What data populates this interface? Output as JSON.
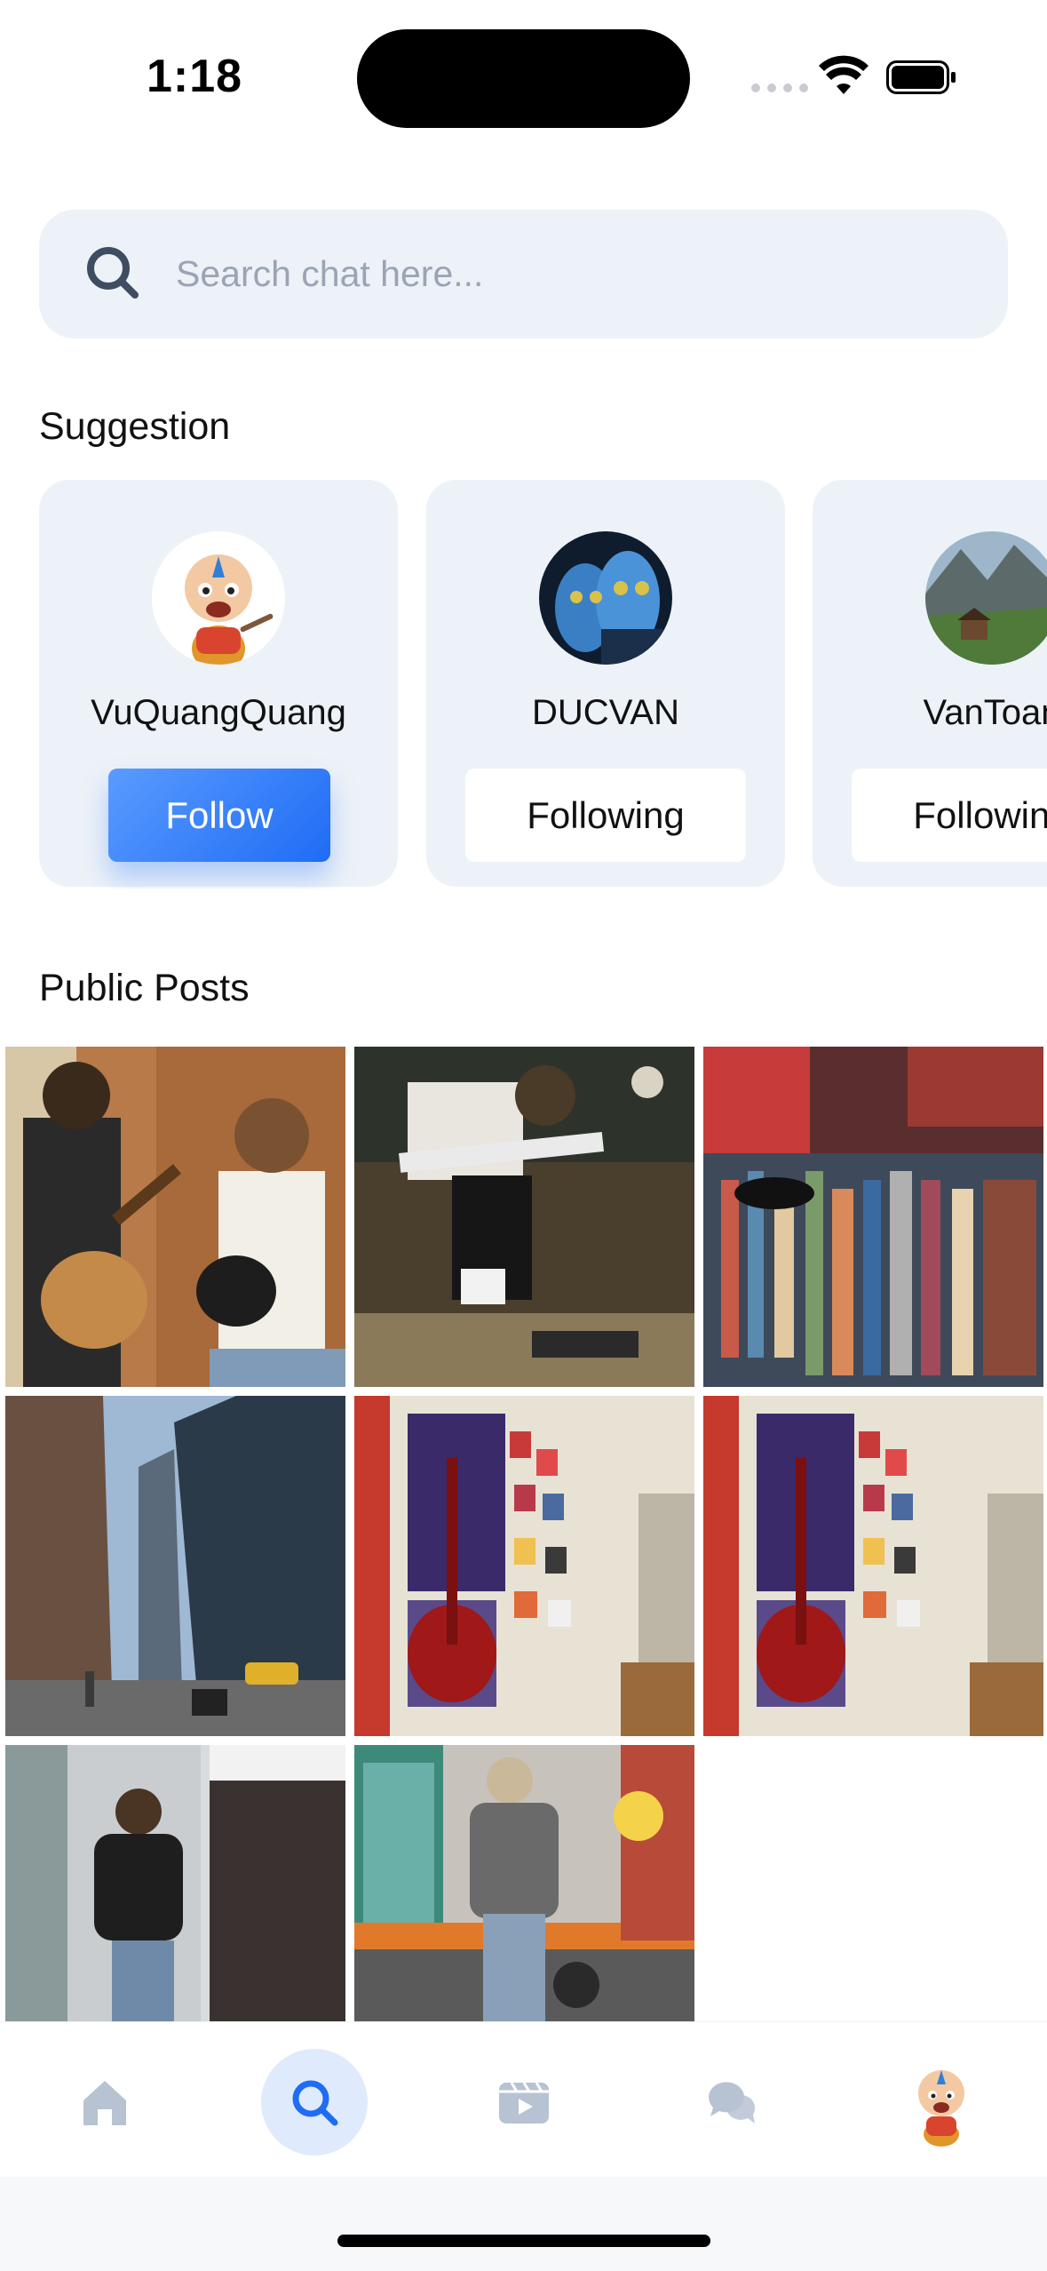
{
  "status_bar": {
    "time": "1:18"
  },
  "search": {
    "placeholder": "Search chat here..."
  },
  "suggestion": {
    "title": "Suggestion",
    "cards": [
      {
        "name": "VuQuangQuang",
        "button": "Follow",
        "state": "follow",
        "avatar": "cartoon-boy-avatar"
      },
      {
        "name": "DUCVAN",
        "button": "Following",
        "state": "following",
        "avatar": "blue-faces-avatar"
      },
      {
        "name": "VanToan",
        "button": "Following",
        "state": "following",
        "avatar": "mountain-landscape-avatar"
      }
    ]
  },
  "public_posts": {
    "title": "Public Posts",
    "items": [
      {
        "subject": "two guitarists indoors"
      },
      {
        "subject": "guitarist with pedals"
      },
      {
        "subject": "vinyl record bins"
      },
      {
        "subject": "city street skyscrapers"
      },
      {
        "subject": "red guitar poster wall"
      },
      {
        "subject": "red guitar poster wall"
      },
      {
        "subject": "person by elevator"
      },
      {
        "subject": "person on scooter street"
      }
    ]
  },
  "tabbar": {
    "items": [
      "home",
      "search",
      "videos",
      "chats",
      "profile"
    ],
    "active": "search"
  },
  "colors": {
    "accent": "#1f6cf5",
    "card_bg": "#edf2f8",
    "icon_muted": "#b7c2d2"
  }
}
